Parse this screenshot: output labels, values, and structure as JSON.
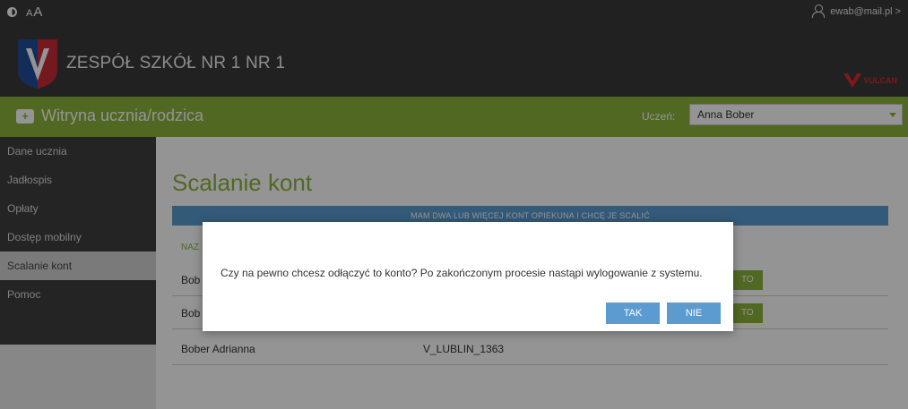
{
  "topbar": {
    "font_small": "A",
    "font_large": "A",
    "user_email": "ewab@mail.pl >"
  },
  "header": {
    "school_name": "ZESPÓŁ SZKÓŁ NR 1 NR 1",
    "vulcan_label": "VULCAN"
  },
  "greenbar": {
    "title": "Witryna ucznia/rodzica",
    "student_label": "Uczeń:",
    "student_selected": "Anna Bober"
  },
  "sidebar": {
    "items": [
      {
        "label": "Dane ucznia"
      },
      {
        "label": "Jadłospis"
      },
      {
        "label": "Opłaty"
      },
      {
        "label": "Dostęp mobilny"
      },
      {
        "label": "Scalanie kont"
      },
      {
        "label": "Pomoc"
      }
    ]
  },
  "content": {
    "page_title": "Scalanie kont",
    "section_header": "MAM DWA LUB WIĘCEJ KONT OPIEKUNA I CHCĘ JE SCALIĆ",
    "column_name": "NAZ",
    "rows": [
      {
        "name": "Bob",
        "login": "",
        "button": "TO"
      },
      {
        "name": "Bob",
        "login": "",
        "button": "TO"
      },
      {
        "name": "Bober Adrianna",
        "login": "V_LUBLIN_1363",
        "button": ""
      }
    ]
  },
  "modal": {
    "message": "Czy na pewno chcesz odłączyć to konto? Po zakończonym procesie nastąpi wylogowanie z systemu.",
    "yes_label": "TAK",
    "no_label": "NIE"
  },
  "colors": {
    "header_bg": "#3a3a3a",
    "accent_green": "#8cb43c",
    "accent_blue": "#5b9bd0",
    "sidebar_bg": "#3e3e3e"
  }
}
